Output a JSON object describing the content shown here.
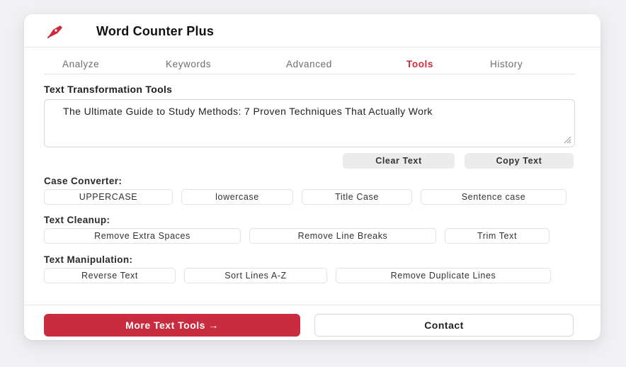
{
  "app": {
    "title": "Word Counter Plus",
    "accent": "#c82c3e"
  },
  "tabs": [
    {
      "label": "Analyze",
      "active": false
    },
    {
      "label": "Keywords",
      "active": false
    },
    {
      "label": "Advanced",
      "active": false
    },
    {
      "label": "Tools",
      "active": true
    },
    {
      "label": "History",
      "active": false
    }
  ],
  "tools": {
    "section_title": "Text Transformation Tools",
    "text_value": "The Ultimate Guide to Study Methods: 7 Proven Techniques That Actually Work",
    "clear_label": "Clear Text",
    "copy_label": "Copy Text"
  },
  "case_converter": {
    "label": "Case Converter:",
    "buttons": [
      "UPPERCASE",
      "lowercase",
      "Title Case",
      "Sentence case"
    ]
  },
  "text_cleanup": {
    "label": "Text Cleanup:",
    "buttons": [
      "Remove Extra Spaces",
      "Remove Line Breaks",
      "Trim Text"
    ]
  },
  "text_manipulation": {
    "label": "Text Manipulation:",
    "buttons": [
      "Reverse Text",
      "Sort Lines A-Z",
      "Remove Duplicate Lines"
    ]
  },
  "footer": {
    "more_tools_label": "More Text Tools →",
    "contact_label": "Contact"
  }
}
